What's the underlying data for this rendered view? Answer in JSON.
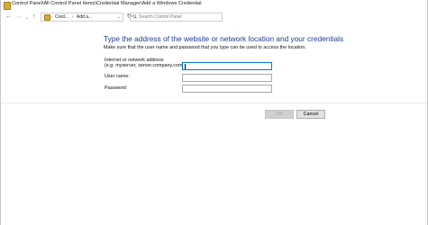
{
  "window": {
    "title": "Control Panel\\All Control Panel Items\\Credential Manager\\Add a Windows Credential"
  },
  "nav": {
    "back_icon": "←",
    "forward_icon": "→",
    "recent_icon": "⌄",
    "up_icon": "↑",
    "refresh_icon": "↻"
  },
  "address": {
    "segments": [
      "Cred...",
      "Add a..."
    ],
    "separator": "›",
    "dropdown": "⌄"
  },
  "search": {
    "placeholder": "Search Control Panel"
  },
  "form": {
    "heading": "Type the address of the website or network location and your credentials",
    "subtext": "Make sure that the user name and password that you type can be used to access the location.",
    "address_label_line1": "Internet or network address",
    "address_label_line2": "(e.g. myserver, server.company.com):",
    "address_value": "",
    "username_label": "User name:",
    "username_value": "",
    "password_label": "Password:",
    "password_value": ""
  },
  "buttons": {
    "ok": "OK",
    "cancel": "Cancel"
  },
  "colors": {
    "heading": "#1e3d8f",
    "focus_border": "#0078d7"
  }
}
